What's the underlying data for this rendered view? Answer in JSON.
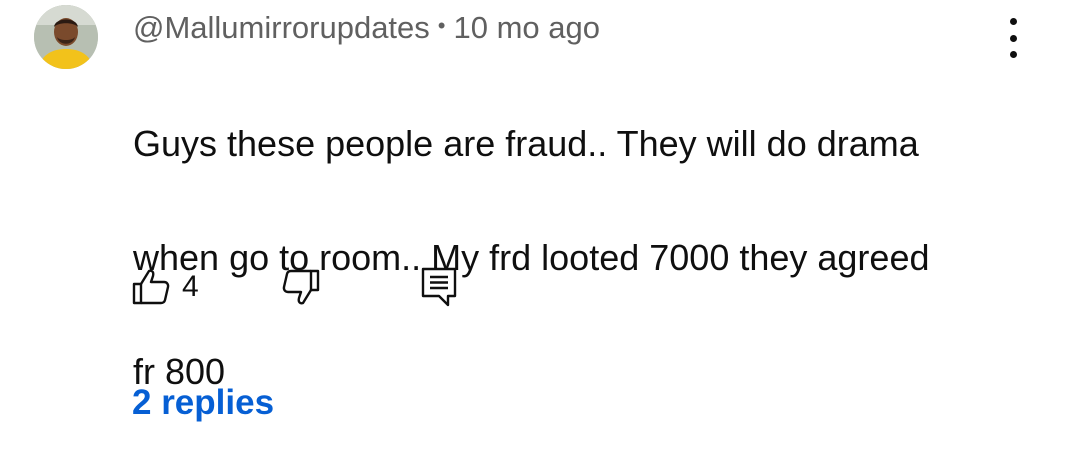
{
  "comment": {
    "author_handle": "@Mallumirrorupdates",
    "separator": "•",
    "time_ago": "10 mo ago",
    "text_line_1": "Guys these people are fraud.. They will do drama",
    "text_line_2": "when go to room.. My frd looted 7000 they agreed",
    "text_line_3": "fr 800",
    "like_count": "4",
    "replies_label": "2 replies"
  },
  "icons": {
    "avatar": "avatar",
    "more": "more-vertical-icon",
    "like": "thumbs-up-icon",
    "dislike": "thumbs-down-icon",
    "reply": "reply-comment-icon"
  },
  "colors": {
    "text_primary": "#0f0f0f",
    "text_secondary": "#606060",
    "link_blue": "#065fd4",
    "background": "#ffffff"
  }
}
